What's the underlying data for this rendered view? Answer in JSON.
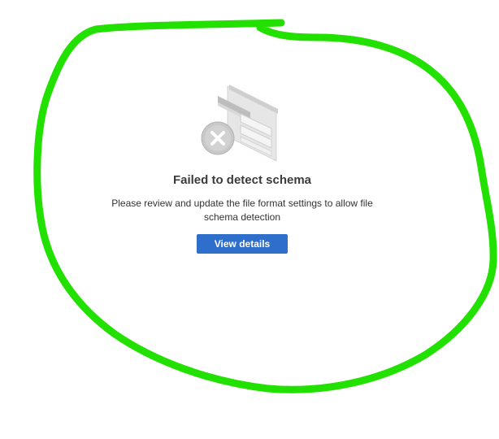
{
  "empty_state": {
    "illustration_icon": "schema-error-icon",
    "title": "Failed to detect schema",
    "message": "Please review and update the file format settings to allow file schema detection",
    "button_label": "View details"
  },
  "annotation": {
    "shape": "hand-drawn circle",
    "color": "#22e000"
  },
  "colors": {
    "button": "#2f6fcb",
    "button_text": "#ffffff",
    "title": "#3b3b3b"
  }
}
